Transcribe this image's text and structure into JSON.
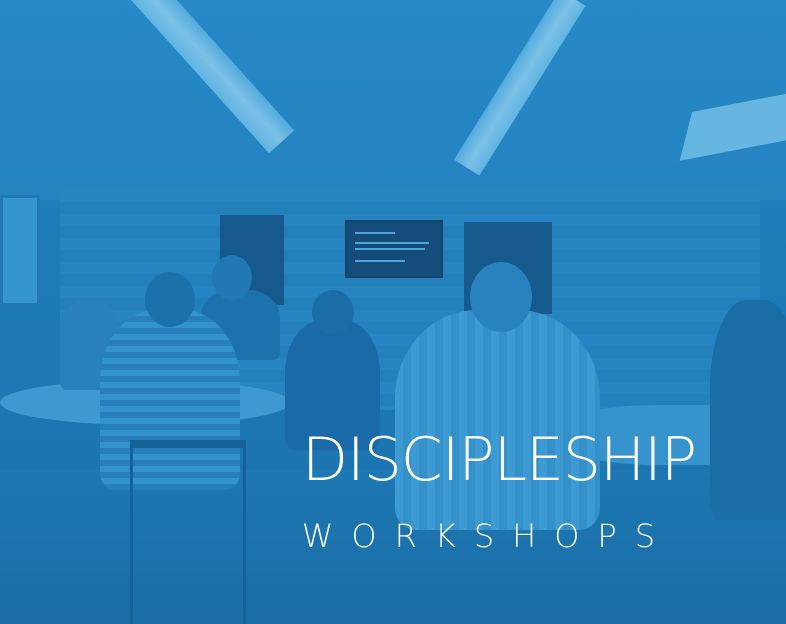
{
  "banner": {
    "title": "DISCIPLESHIP",
    "subtitle": "WORKSHOPS"
  },
  "colors": {
    "overlay": "#1f7cb8",
    "text": "#ffffff"
  }
}
